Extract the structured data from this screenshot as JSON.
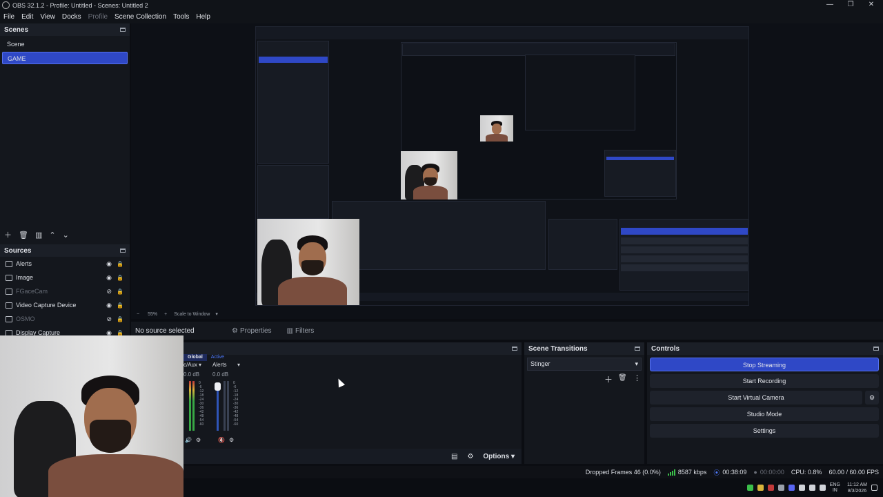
{
  "window": {
    "title": "OBS 32.1.2 - Profile: Untitled - Scenes: Untitled 2",
    "controls": [
      "—",
      "❐",
      "✕"
    ]
  },
  "menu": [
    "File",
    "Edit",
    "View",
    "Docks",
    "Profile",
    "Scene Collection",
    "Tools",
    "Help"
  ],
  "scenes": {
    "title": "Scenes",
    "items": [
      "Scene",
      "GAME"
    ],
    "selected": "GAME"
  },
  "sources": {
    "title": "Sources",
    "items": [
      {
        "label": "Alerts",
        "dim": false
      },
      {
        "label": "Image",
        "dim": false
      },
      {
        "label": "FGaceCam",
        "dim": true
      },
      {
        "label": "Video Capture Device",
        "dim": false
      },
      {
        "label": "OSMO",
        "dim": true
      },
      {
        "label": "Display Capture",
        "dim": false
      }
    ]
  },
  "zoom": {
    "percent": "55%",
    "plus": "+",
    "mode": "Scale to Window",
    "minus": "−"
  },
  "properties_bar": {
    "no_source": "No source selected",
    "properties": "Properties",
    "filters": "Filters"
  },
  "mixer": {
    "tabs": [
      "Global",
      "Active"
    ],
    "tracks": [
      {
        "name": "c/Aux",
        "db": "0.0 dB"
      },
      {
        "name": "Alerts",
        "db": "0.0 dB"
      }
    ],
    "scale": [
      "0",
      "-6",
      "-12",
      "-18",
      "-24",
      "-30",
      "-36",
      "-42",
      "-48",
      "-54",
      "-60"
    ],
    "options": "Options"
  },
  "transitions": {
    "title": "Scene Transitions",
    "selected": "Stinger"
  },
  "controls": {
    "title": "Controls",
    "buttons": [
      "Stop Streaming",
      "Start Recording",
      "Start Virtual Camera",
      "Studio Mode",
      "Settings"
    ]
  },
  "status": {
    "dropped": "Dropped Frames 46 (0.0%)",
    "kbps": "8587 kbps",
    "stream_time": "00:38:09",
    "rec_time": "00:00:00",
    "cpu": "CPU: 0.8%",
    "fps": "60.00 / 60.00 FPS"
  },
  "taskbar": {
    "lang": "ENG",
    "region": "IN",
    "time": "11:12 AM",
    "date": "8/3/2026"
  },
  "colors": {
    "accent": "#2f48c6",
    "panel": "#14171d",
    "bg": "#0b0d12",
    "meter_green": "#38a845"
  },
  "icons": [
    "obs-logo-icon",
    "dock-float-icon",
    "add-icon",
    "trash-icon",
    "filter-icon",
    "up-icon",
    "down-icon",
    "eye-icon",
    "eye-hidden-icon",
    "lock-icon",
    "gear-icon",
    "speaker-icon",
    "chevron-down-icon",
    "more-icon",
    "signal-icon"
  ]
}
